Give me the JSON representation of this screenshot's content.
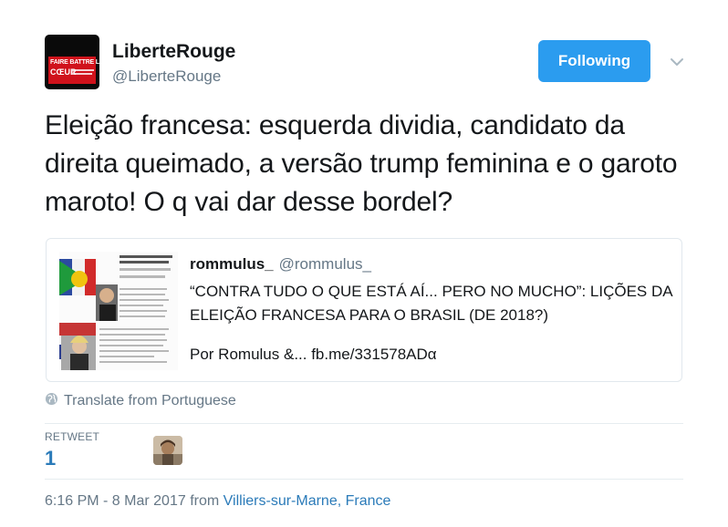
{
  "tweet": {
    "author": {
      "display_name": "LiberteRouge",
      "screen_name": "@LiberteRouge",
      "avatar_text_line1": "FAIRE BATTRE LE",
      "avatar_text_line2": "CŒUR"
    },
    "follow_button_label": "Following",
    "text": "Eleição francesa: esquerda dividia, candidato da direita queimado, a versão trump feminina e o garoto maroto! O q vai dar desse bordel?",
    "quoted": {
      "display_name": "rommulus_",
      "screen_name": "@rommulus_",
      "text": "“CONTRA TUDO O QUE ESTÁ AÍ... PERO NO MUCHO”: LIÇÕES DA ELEIÇÃO FRANCESA PARA O BRASIL (DE 2018?)",
      "text_tail": "Por Romulus &... fb.me/331578ADα",
      "thumb_heading": "“CONTRA TUDO O QUE LIÇÕES DA ELEIÇÃO FI 2018?)"
    },
    "translate_label": "Translate from Portuguese",
    "stats": {
      "retweet_label": "RETWEET",
      "retweet_count": "1"
    },
    "timestamp": "6:16 PM - 8 Mar 2017",
    "from_label": "from",
    "location": "Villiers-sur-Marne, France"
  },
  "icons": {
    "caret": "chevron-down-icon",
    "translate": "globe-icon"
  },
  "colors": {
    "follow_button": "#2b9cef",
    "link": "#2b7bb9",
    "muted": "#657786",
    "avatar_red": "#d0121b"
  }
}
